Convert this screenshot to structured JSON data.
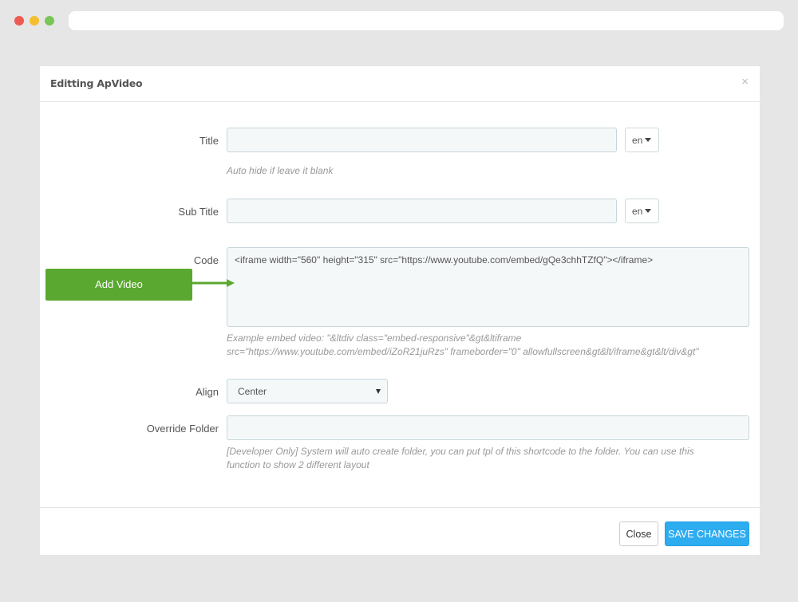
{
  "modal": {
    "title": "Editting ApVideo",
    "close_glyph": "×"
  },
  "form": {
    "title_label": "Title",
    "title_value": "",
    "title_lang": "en",
    "title_help": "Auto hide if leave it blank",
    "subtitle_label": "Sub Title",
    "subtitle_value": "",
    "subtitle_lang": "en",
    "code_label": "Code",
    "code_value": "<iframe width=\"560\" height=\"315\" src=\"https://www.youtube.com/embed/gQe3chhTZfQ\"></iframe>",
    "code_help_line1": "Example embed video: \"&ltdiv class=\"embed-responsive\"&gt&ltiframe",
    "code_help_line2": "src=\"https://www.youtube.com/embed/iZoR21juRzs\" frameborder=\"0\" allowfullscreen&gt&lt/iframe&gt&lt/div&gt\"",
    "align_label": "Align",
    "align_value": "Center",
    "override_label": "Override Folder",
    "override_value": "",
    "override_help_line1": "[Developer Only] System will auto create folder, you can put tpl of this shortcode to the folder. You can use this",
    "override_help_line2": "function to show 2 different layout"
  },
  "footer": {
    "close_label": "Close",
    "save_label": "SAVE CHANGES"
  },
  "annotation": {
    "label": "Add Video"
  },
  "colors": {
    "save_button": "#2eacf0",
    "callout": "#5aa82f",
    "input_bg": "#f5f8f9",
    "input_border": "#c7d6db"
  }
}
